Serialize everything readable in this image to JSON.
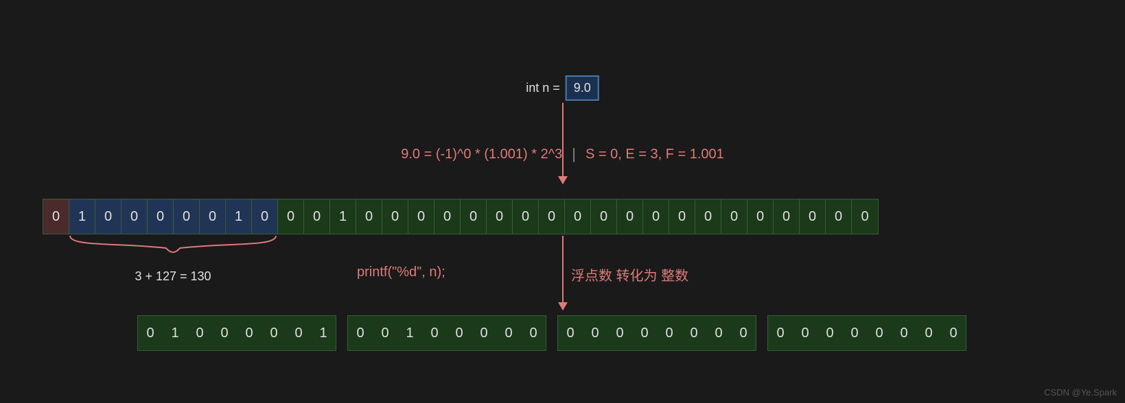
{
  "declaration": {
    "lhs": "int  n  =",
    "rhs": "9.0"
  },
  "formula": {
    "left": "9.0  =  (-1)^0  *  (1.001)  *  2^3",
    "right": "S  =  0,   E  =  3,   F  =  1.001"
  },
  "bits32": [
    "0",
    "1",
    "0",
    "0",
    "0",
    "0",
    "0",
    "1",
    "0",
    "0",
    "0",
    "1",
    "0",
    "0",
    "0",
    "0",
    "0",
    "0",
    "0",
    "0",
    "0",
    "0",
    "0",
    "0",
    "0",
    "0",
    "0",
    "0",
    "0",
    "0",
    "0",
    "0"
  ],
  "bit_roles": [
    "sign",
    "exp",
    "exp",
    "exp",
    "exp",
    "exp",
    "exp",
    "exp",
    "exp",
    "frac",
    "frac",
    "frac",
    "frac",
    "frac",
    "frac",
    "frac",
    "frac",
    "frac",
    "frac",
    "frac",
    "frac",
    "frac",
    "frac",
    "frac",
    "frac",
    "frac",
    "frac",
    "frac",
    "frac",
    "frac",
    "frac",
    "frac"
  ],
  "brace_label": "3  +  127 =  130",
  "printf_text": "printf(\"%d\", n);",
  "convert_text": "浮点数 转化为 整数",
  "byte_groups": [
    [
      "0",
      "1",
      "0",
      "0",
      "0",
      "0",
      "0",
      "1"
    ],
    [
      "0",
      "0",
      "1",
      "0",
      "0",
      "0",
      "0",
      "0"
    ],
    [
      "0",
      "0",
      "0",
      "0",
      "0",
      "0",
      "0",
      "0"
    ],
    [
      "0",
      "0",
      "0",
      "0",
      "0",
      "0",
      "0",
      "0"
    ]
  ],
  "watermark": "CSDN @Ye.Spark"
}
